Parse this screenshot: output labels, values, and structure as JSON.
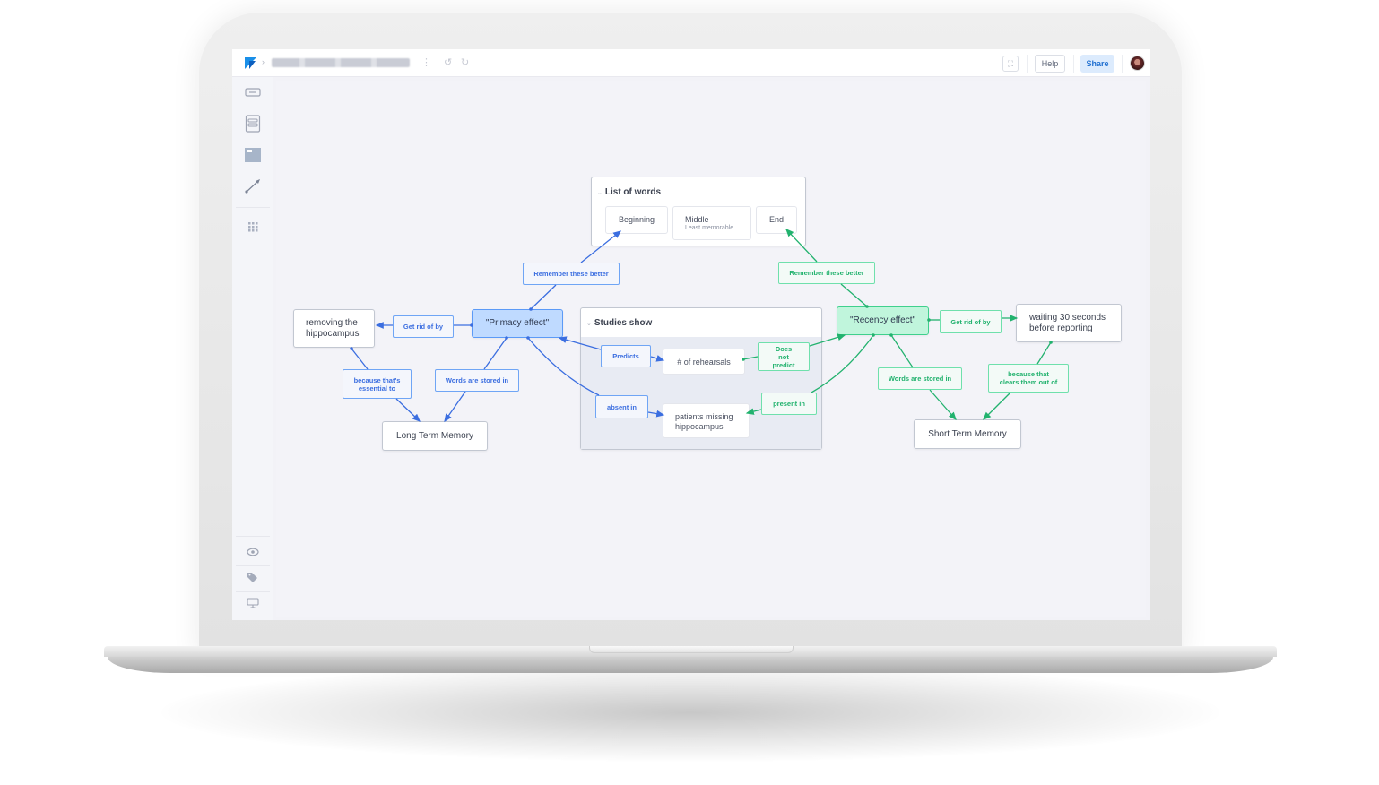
{
  "app": {
    "doc_title": "Psychology Concept Map",
    "toolbar": {
      "breadcrumb_sep": "›",
      "more_icon": "⋮",
      "undo_icon": "↺",
      "redo_icon": "↻",
      "fullscreen_icon": "⛶",
      "help_label": "Help",
      "share_label": "Share"
    },
    "sidebar": {
      "tools": [
        "text-box-tool",
        "list-tool",
        "image-block-tool",
        "connector-tool",
        "grid-tool"
      ],
      "bottom": [
        "eye-icon",
        "tag-icon",
        "present-icon"
      ]
    },
    "colors": {
      "primacy": "#3b6ee0",
      "recency": "#22b26e",
      "share_bg": "#dcebfd"
    }
  },
  "map": {
    "list_group": {
      "title": "List of words",
      "items": [
        {
          "label": "Beginning",
          "sub": ""
        },
        {
          "label": "Middle",
          "sub": "Least memorable"
        },
        {
          "label": "End",
          "sub": ""
        }
      ]
    },
    "studies_group": {
      "title": "Studies show",
      "items": [
        "# of rehearsals",
        "patients missing hippocampus"
      ]
    },
    "nodes": {
      "primacy": "\"Primacy effect\"",
      "recency": "\"Recency effect\"",
      "hippocampus": "removing the hippocampus",
      "ltm": "Long Term Memory",
      "stm": "Short Term Memory",
      "waiting": "waiting 30 seconds before reporting"
    },
    "labels": {
      "remember_blue": "Remember these better",
      "remember_green": "Remember these better",
      "getrid_blue": "Get rid of by",
      "getrid_green": "Get rid of by",
      "essential": "because that's essential to",
      "stored_blue": "Words are stored in",
      "stored_green": "Words are stored in",
      "clears": "because that clears them out of",
      "predicts": "Predicts",
      "absent": "absent in",
      "not_predict": "Does not predict",
      "present": "present in"
    }
  }
}
